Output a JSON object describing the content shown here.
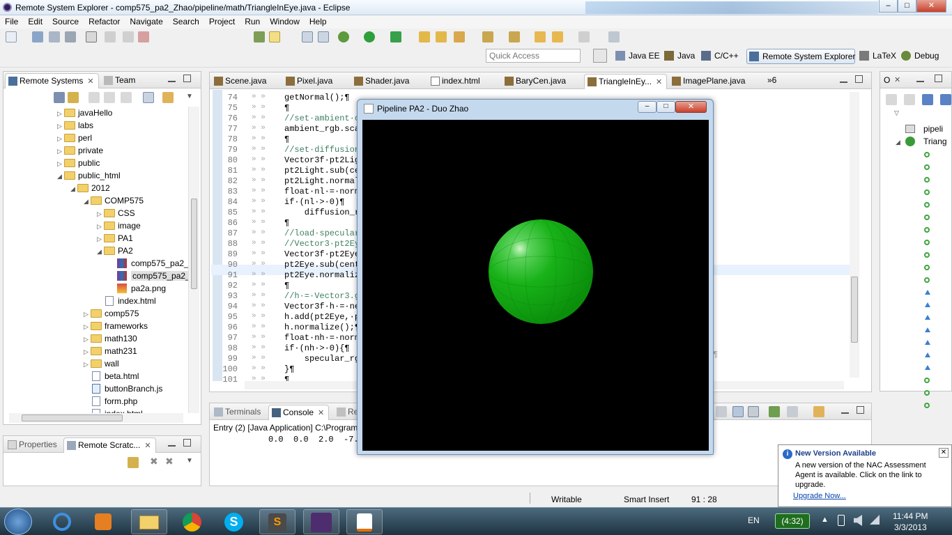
{
  "window": {
    "title": "Remote System Explorer - comp575_pa2_Zhao/pipeline/math/TriangleInEye.java - Eclipse",
    "minimize": "–",
    "maximize": "□",
    "close": "✕"
  },
  "menu": [
    "File",
    "Edit",
    "Source",
    "Refactor",
    "Navigate",
    "Search",
    "Project",
    "Run",
    "Window",
    "Help"
  ],
  "quick_access": {
    "placeholder": "Quick Access"
  },
  "perspectives": [
    {
      "label": "Java EE"
    },
    {
      "label": "Java"
    },
    {
      "label": "C/C++"
    },
    {
      "label": "Remote System Explorer",
      "active": true
    },
    {
      "label": "LaTeX"
    },
    {
      "label": "Debug"
    }
  ],
  "left_panel": {
    "tabs": [
      "Remote Systems",
      "Team"
    ],
    "tree": [
      {
        "label": "javaHello",
        "type": "folder",
        "depth": 1,
        "exp": "closed"
      },
      {
        "label": "labs",
        "type": "folder",
        "depth": 1,
        "exp": "closed"
      },
      {
        "label": "perl",
        "type": "folder",
        "depth": 1,
        "exp": "closed"
      },
      {
        "label": "private",
        "type": "folder",
        "depth": 1,
        "exp": "closed"
      },
      {
        "label": "public",
        "type": "folder",
        "depth": 1,
        "exp": "closed"
      },
      {
        "label": "public_html",
        "type": "folder",
        "depth": 1,
        "exp": "open"
      },
      {
        "label": "2012",
        "type": "folder",
        "depth": 2,
        "exp": "open"
      },
      {
        "label": "COMP575",
        "type": "folder",
        "depth": 3,
        "exp": "open"
      },
      {
        "label": "CSS",
        "type": "folder",
        "depth": 4,
        "exp": "closed"
      },
      {
        "label": "image",
        "type": "folder",
        "depth": 4,
        "exp": "closed"
      },
      {
        "label": "PA1",
        "type": "folder",
        "depth": 4,
        "exp": "closed"
      },
      {
        "label": "PA2",
        "type": "folder",
        "depth": 4,
        "exp": "open"
      },
      {
        "label": "comp575_pa2_",
        "type": "rar",
        "depth": 5,
        "exp": "none"
      },
      {
        "label": "comp575_pa2_",
        "type": "rar",
        "depth": 5,
        "exp": "none",
        "selected": true
      },
      {
        "label": "pa2a.png",
        "type": "png",
        "depth": 5,
        "exp": "none"
      },
      {
        "label": "index.html",
        "type": "file",
        "depth": 4,
        "exp": "none"
      },
      {
        "label": "comp575",
        "type": "folder",
        "depth": 3,
        "exp": "closed"
      },
      {
        "label": "frameworks",
        "type": "folder",
        "depth": 3,
        "exp": "closed"
      },
      {
        "label": "math130",
        "type": "folder",
        "depth": 3,
        "exp": "closed"
      },
      {
        "label": "math231",
        "type": "folder",
        "depth": 3,
        "exp": "closed"
      },
      {
        "label": "wall",
        "type": "folder",
        "depth": 3,
        "exp": "closed"
      },
      {
        "label": "beta.html",
        "type": "file",
        "depth": 3,
        "exp": "none"
      },
      {
        "label": "buttonBranch.js",
        "type": "js",
        "depth": 3,
        "exp": "none"
      },
      {
        "label": "form.php",
        "type": "file",
        "depth": 3,
        "exp": "none"
      },
      {
        "label": "index.html",
        "type": "file",
        "depth": 3,
        "exp": "none"
      }
    ]
  },
  "bottom_left_panel": {
    "tabs": [
      "Properties",
      "Remote Scratc..."
    ]
  },
  "editor": {
    "tabs": [
      {
        "label": "Scene.java"
      },
      {
        "label": "Pixel.java"
      },
      {
        "label": "Shader.java"
      },
      {
        "label": "index.html"
      },
      {
        "label": "BaryCen.java"
      },
      {
        "label": "TriangleInEy...",
        "active": true
      },
      {
        "label": "ImagePlane.java"
      }
    ],
    "overflow": "»6",
    "lines": [
      {
        "n": "74",
        "text": "getNormal();¶"
      },
      {
        "n": "75",
        "text": "¶"
      },
      {
        "n": "76",
        "text": "//set·ambient·c"
      },
      {
        "n": "77",
        "text": "ambient_rgb.sca"
      },
      {
        "n": "78",
        "text": "¶"
      },
      {
        "n": "79",
        "text": "//set·diffusion"
      },
      {
        "n": "80",
        "text": "Vector3f·pt2Lig"
      },
      {
        "n": "81",
        "text": "pt2Light.sub(ce"
      },
      {
        "n": "82",
        "text": "pt2Light.normal"
      },
      {
        "n": "83",
        "text": "float·nl·=·norm"
      },
      {
        "n": "84",
        "text": "if·(nl·>·0)¶"
      },
      {
        "n": "85",
        "text": "    diffusion_r"
      },
      {
        "n": "86",
        "text": "¶"
      },
      {
        "n": "87",
        "text": "//load·specular"
      },
      {
        "n": "88",
        "text": "//Vector3·pt2Ey"
      },
      {
        "n": "89",
        "text": "Vector3f·pt2Eye"
      },
      {
        "n": "90",
        "text": "pt2Eye.sub(cent"
      },
      {
        "n": "91",
        "text": "pt2Eye.normaliz"
      },
      {
        "n": "92",
        "text": "¶"
      },
      {
        "n": "93",
        "text": "//h·=·Vector3.g"
      },
      {
        "n": "94",
        "text": "Vector3f·h·=·ne"
      },
      {
        "n": "95",
        "text": "h.add(pt2Eye,·p"
      },
      {
        "n": "96",
        "text": "h.normalize();¶"
      },
      {
        "n": "97",
        "text": "float·nh·=·norm"
      },
      {
        "n": "98",
        "text": "if·(nh·>·0){¶"
      },
      {
        "n": "99",
        "text": "    specular_rg"
      },
      {
        "n": "100",
        "text": "}¶"
      },
      {
        "n": "101",
        "text": "¶"
      }
    ],
    "trailing_pilcrow": "¶"
  },
  "console": {
    "tabs": [
      "Terminals",
      "Console",
      "Re"
    ],
    "header": "Entry (2) [Java Application] C:\\Program",
    "output": "0.0  0.0  2.0  -7."
  },
  "java_window": {
    "title": "Pipeline PA2 - Duo Zhao",
    "sphere_color": "#16b016"
  },
  "outline_panel": {
    "tab": "O",
    "items": [
      "pipeli",
      "Triang"
    ]
  },
  "status": {
    "writable": "Writable",
    "insert": "Smart Insert",
    "position": "91 : 28"
  },
  "notification": {
    "title": "New Version Available",
    "body": "A new version of the NAC Assessment Agent is available.  Click on the link to upgrade.",
    "link": "Upgrade Now..."
  },
  "taskbar": {
    "lang": "EN",
    "battery": "(4:32)",
    "time": "11:44 PM",
    "date": "3/3/2013"
  }
}
